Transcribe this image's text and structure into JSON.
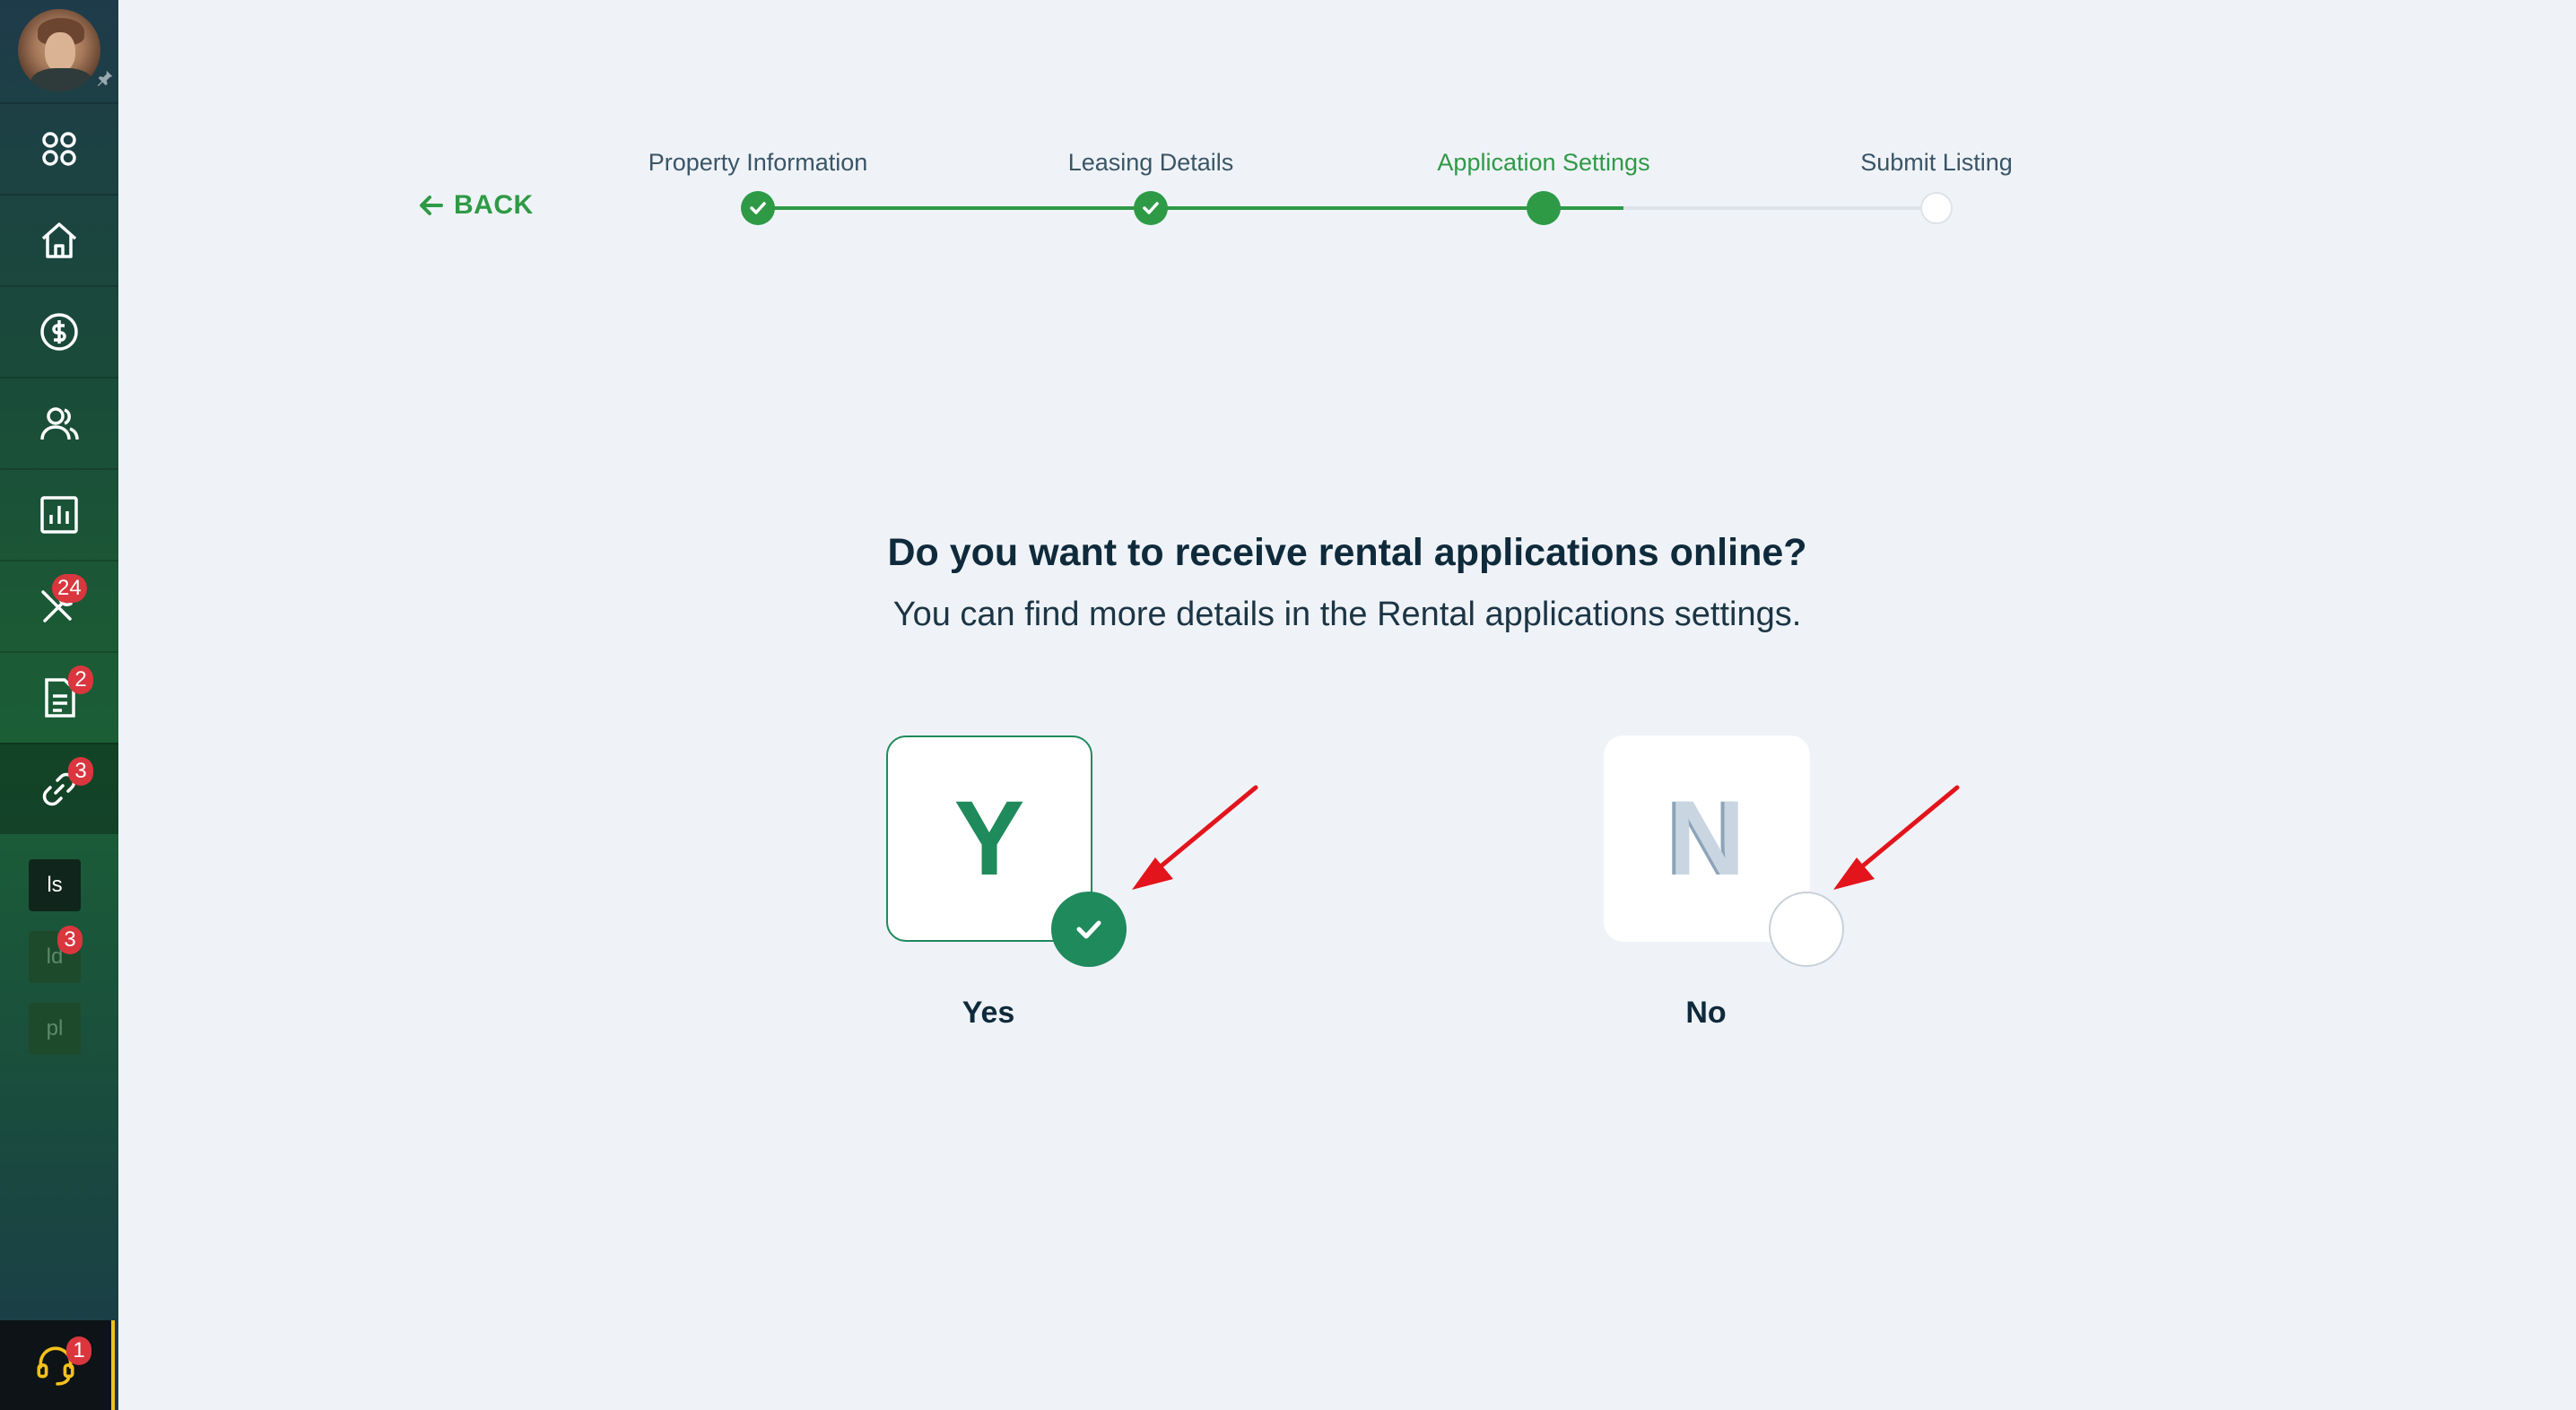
{
  "sidebar": {
    "badges": {
      "maintenance": "24",
      "documents": "2",
      "links": "3",
      "mini_ld": "3",
      "support": "1"
    },
    "mini_items": [
      "ls",
      "ld",
      "pl"
    ],
    "icons": [
      "apps-grid-icon",
      "home-icon",
      "dollar-icon",
      "people-icon",
      "bar-chart-icon",
      "tools-icon",
      "document-icon",
      "link-icon",
      "headset-icon"
    ]
  },
  "stepper": {
    "back_label": "BACK",
    "steps": [
      {
        "label": "Property Information",
        "state": "complete"
      },
      {
        "label": "Leasing Details",
        "state": "complete"
      },
      {
        "label": "Application Settings",
        "state": "current"
      },
      {
        "label": "Submit Listing",
        "state": "upcoming"
      }
    ]
  },
  "question": {
    "title": "Do you want to receive rental applications online?",
    "subtitle": "You can find more details in the Rental applications settings."
  },
  "options": [
    {
      "letter": "Y",
      "label": "Yes",
      "selected": true
    },
    {
      "letter": "N",
      "label": "No",
      "selected": false
    }
  ],
  "colors": {
    "accent": "#2f9a46",
    "selected": "#1f8a5c",
    "badge": "#d9363e",
    "annotation_arrow": "#e3141b"
  }
}
